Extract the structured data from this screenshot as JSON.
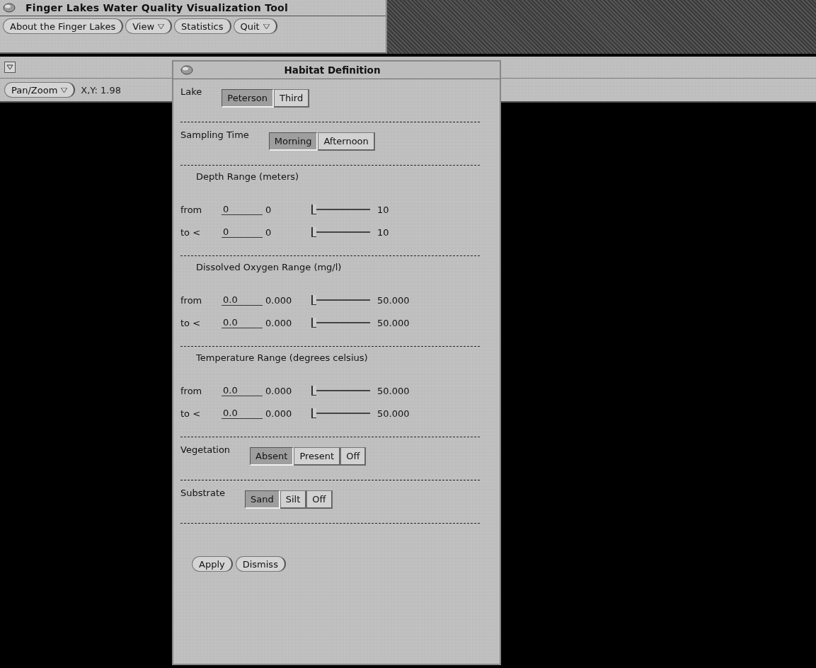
{
  "app_window": {
    "title": "Finger Lakes Water Quality Visualization Tool",
    "menu": [
      {
        "label": "About the Finger Lakes",
        "kind": "button"
      },
      {
        "label": "View",
        "kind": "menu"
      },
      {
        "label": "Statistics",
        "kind": "button"
      },
      {
        "label": "Quit",
        "kind": "menu"
      }
    ]
  },
  "view_window": {
    "toolbar": [
      {
        "label": "Pan/Zoom",
        "kind": "menu"
      }
    ],
    "coordinates": "X,Y: 1.98"
  },
  "dialog": {
    "title": "Habitat Definition",
    "sections": [
      {
        "kind": "choice",
        "label": "Lake",
        "options": [
          {
            "label": "Peterson",
            "selected": true
          },
          {
            "label": "Third",
            "selected": false
          }
        ]
      },
      {
        "kind": "choice",
        "label": "Sampling Time",
        "options": [
          {
            "label": "Morning",
            "selected": true
          },
          {
            "label": "Afternoon",
            "selected": false
          }
        ]
      },
      {
        "kind": "range",
        "heading": "Depth Range (meters)",
        "rows": [
          {
            "label": "from",
            "value": "0",
            "min": "0",
            "max": "10",
            "level": 0
          },
          {
            "label": "to <",
            "value": "0",
            "min": "0",
            "max": "10",
            "level": 0
          }
        ]
      },
      {
        "kind": "range",
        "heading": "Dissolved Oxygen Range (mg/l)",
        "rows": [
          {
            "label": "from",
            "value": "0.0",
            "min": "0.000",
            "max": "50.000",
            "level": 0
          },
          {
            "label": "to <",
            "value": "0.0",
            "min": "0.000",
            "max": "50.000",
            "level": 0
          }
        ]
      },
      {
        "kind": "range",
        "heading": "Temperature Range (degrees celsius)",
        "rows": [
          {
            "label": "from",
            "value": "0.0",
            "min": "0.000",
            "max": "50.000",
            "level": 0
          },
          {
            "label": "to <",
            "value": "0.0",
            "min": "0.000",
            "max": "50.000",
            "level": 0
          }
        ]
      },
      {
        "kind": "choice",
        "label": "Vegetation",
        "options": [
          {
            "label": "Absent",
            "selected": true
          },
          {
            "label": "Present",
            "selected": false
          },
          {
            "label": "Off",
            "selected": false
          }
        ]
      },
      {
        "kind": "choice",
        "label": "Substrate",
        "options": [
          {
            "label": "Sand",
            "selected": true
          },
          {
            "label": "Silt",
            "selected": false
          },
          {
            "label": "Off",
            "selected": false
          }
        ]
      }
    ],
    "buttons": [
      "Apply",
      "Dismiss"
    ]
  }
}
